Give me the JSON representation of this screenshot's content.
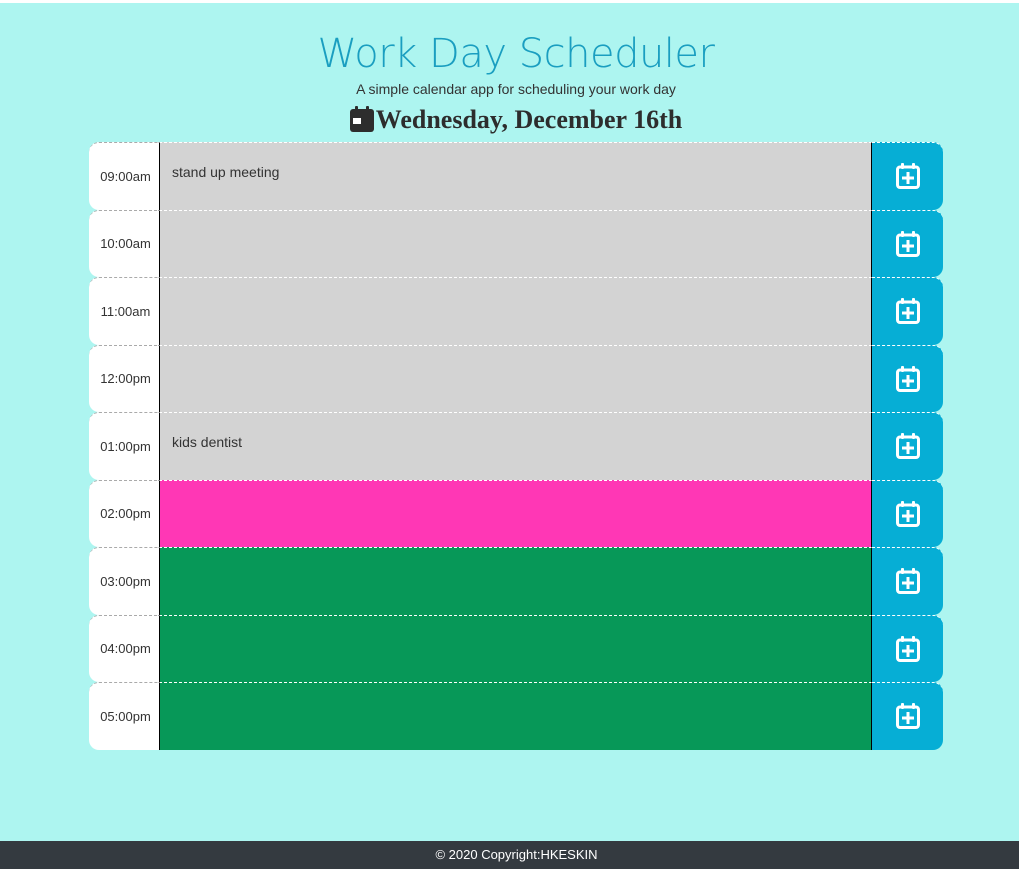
{
  "header": {
    "title": "Work Day Scheduler",
    "subtitle": "A simple calendar app for scheduling your work day",
    "current_date": "Wednesday, December 16th",
    "date_icon": "calendar-icon"
  },
  "schedule": {
    "save_icon": "calendar-plus-icon",
    "rows": [
      {
        "hour": "09:00am",
        "text": "stand up meeting",
        "state": "past"
      },
      {
        "hour": "10:00am",
        "text": "",
        "state": "past"
      },
      {
        "hour": "11:00am",
        "text": "",
        "state": "past"
      },
      {
        "hour": "12:00pm",
        "text": "",
        "state": "past"
      },
      {
        "hour": "01:00pm",
        "text": "kids dentist",
        "state": "past"
      },
      {
        "hour": "02:00pm",
        "text": "",
        "state": "present"
      },
      {
        "hour": "03:00pm",
        "text": "",
        "state": "future"
      },
      {
        "hour": "04:00pm",
        "text": "",
        "state": "future"
      },
      {
        "hour": "05:00pm",
        "text": "",
        "state": "future"
      }
    ]
  },
  "colors": {
    "page_background": "#adf5f0",
    "title": "#1a9ec0",
    "past": "#d3d3d3",
    "present": "#ff37b5",
    "future": "#079858",
    "save_button": "#06aed5",
    "footer_background": "#343a40"
  },
  "footer": {
    "copyright": "© 2020 Copyright:HKESKIN"
  }
}
